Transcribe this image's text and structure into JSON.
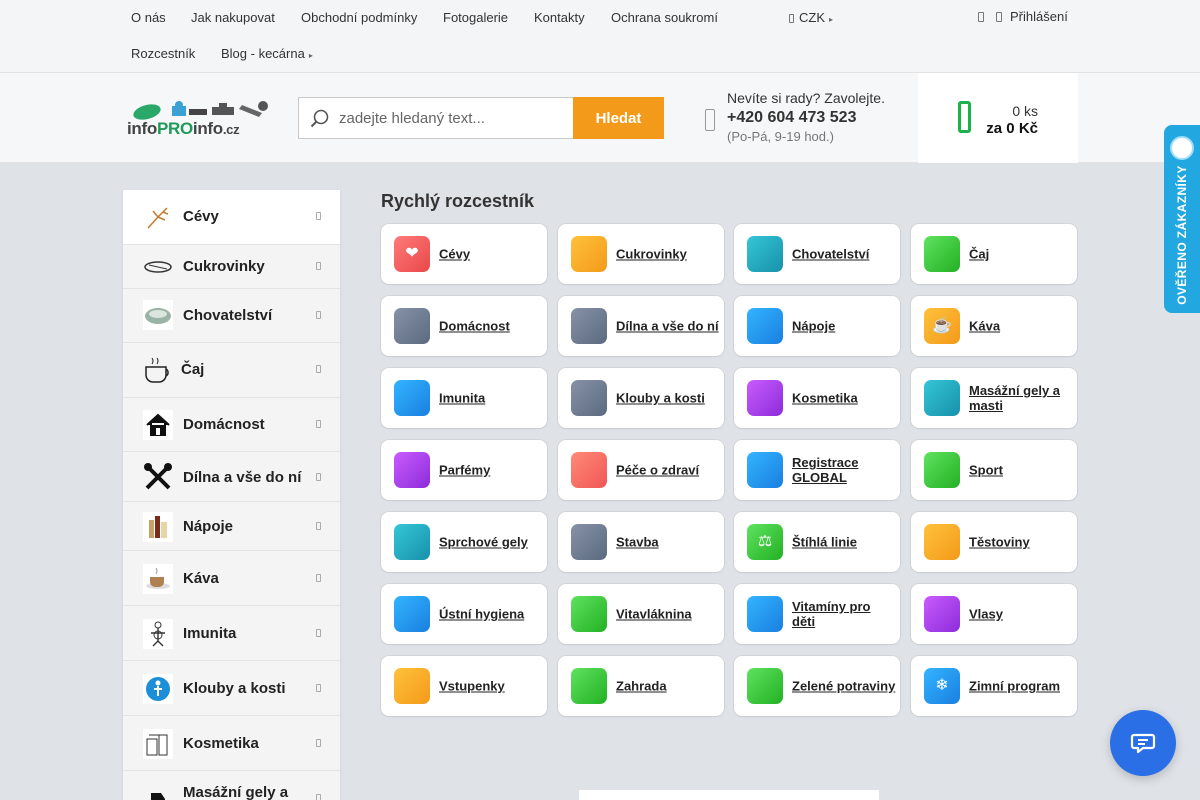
{
  "topnav": {
    "row1": [
      "O nás",
      "Jak nakupovat",
      "Obchodní podmínky",
      "Fotogalerie",
      "Kontakty",
      "Ochrana soukromí"
    ],
    "row2": [
      "Rozcestník",
      "Blog - kecárna"
    ],
    "currency": "CZK",
    "login": "Přihlášení"
  },
  "header": {
    "logo": {
      "part1": "info",
      "part2": "PRO",
      "part3": "info",
      "part4": ".cz"
    },
    "search": {
      "placeholder": "zadejte hledaný text...",
      "button": "Hledat"
    },
    "help": {
      "question": "Nevíte si rady? Zavolejte.",
      "phone": "+420 604 473 523",
      "hours": "(Po-Pá, 9-19 hod.)"
    },
    "cart": {
      "count": "0 ks",
      "total": "za 0 Kč"
    }
  },
  "sidebar": {
    "items": [
      {
        "label": "Cévy",
        "icon": "vein-icon"
      },
      {
        "label": "Cukrovinky",
        "icon": "candy-icon"
      },
      {
        "label": "Chovatelství",
        "icon": "pet-bowl-icon"
      },
      {
        "label": "Čaj",
        "icon": "tea-cup-icon"
      },
      {
        "label": "Domácnost",
        "icon": "house-icon"
      },
      {
        "label": "Dílna a vše do ní",
        "icon": "tools-icon"
      },
      {
        "label": "Nápoje",
        "icon": "drinks-icon"
      },
      {
        "label": "Káva",
        "icon": "coffee-icon"
      },
      {
        "label": "Imunita",
        "icon": "immunity-icon"
      },
      {
        "label": "Klouby a kosti",
        "icon": "joints-icon"
      },
      {
        "label": "Kosmetika",
        "icon": "cosmetics-icon"
      },
      {
        "label": "Masážní gely a",
        "icon": "massage-gel-icon"
      }
    ]
  },
  "main": {
    "title": "Rychlý rozcestník",
    "tiles": [
      {
        "label": "Cévy",
        "icon": "heart-icon",
        "glyph": "❤",
        "color": "red"
      },
      {
        "label": "Cukrovinky",
        "icon": "candy-icon",
        "glyph": "",
        "color": "orange"
      },
      {
        "label": "Chovatelství",
        "icon": "paw-icon",
        "glyph": "",
        "color": "teal"
      },
      {
        "label": "Čaj",
        "icon": "leaf-icon",
        "glyph": "",
        "color": "green"
      },
      {
        "label": "Domácnost",
        "icon": "house-icon",
        "glyph": "",
        "color": "slate"
      },
      {
        "label": "Dílna a vše do ní",
        "icon": "wrench-icon",
        "glyph": "",
        "color": "slate"
      },
      {
        "label": "Nápoje",
        "icon": "bottle-icon",
        "glyph": "",
        "color": "blue"
      },
      {
        "label": "Káva",
        "icon": "coffee-icon",
        "glyph": "☕",
        "color": "orange"
      },
      {
        "label": "Imunita",
        "icon": "shield-icon",
        "glyph": "",
        "color": "blue"
      },
      {
        "label": "Klouby a kosti",
        "icon": "bone-icon",
        "glyph": "",
        "color": "slate"
      },
      {
        "label": "Kosmetika",
        "icon": "lipstick-icon",
        "glyph": "",
        "color": "purple"
      },
      {
        "label": "Masážní gely a masti",
        "icon": "hand-icon",
        "glyph": "",
        "color": "teal"
      },
      {
        "label": "Parfémy",
        "icon": "perfume-icon",
        "glyph": "",
        "color": "purple"
      },
      {
        "label": "Péče o zdraví",
        "icon": "medkit-icon",
        "glyph": "",
        "color": "salmon"
      },
      {
        "label": "Registrace GLOBAL",
        "icon": "globe-icon",
        "glyph": "",
        "color": "blue"
      },
      {
        "label": "Sport",
        "icon": "sport-icon",
        "glyph": "",
        "color": "green"
      },
      {
        "label": "Sprchové gely",
        "icon": "shower-icon",
        "glyph": "",
        "color": "teal"
      },
      {
        "label": "Stavba",
        "icon": "building-icon",
        "glyph": "",
        "color": "slate"
      },
      {
        "label": "Štíhlá linie",
        "icon": "scale-icon",
        "glyph": "⚖",
        "color": "green"
      },
      {
        "label": "Těstoviny",
        "icon": "pasta-icon",
        "glyph": "",
        "color": "orange"
      },
      {
        "label": "Ústní hygiena",
        "icon": "tooth-icon",
        "glyph": "",
        "color": "blue"
      },
      {
        "label": "Vitavláknina",
        "icon": "fiber-icon",
        "glyph": "",
        "color": "green"
      },
      {
        "label": "Vitamíny pro děti",
        "icon": "child-icon",
        "glyph": "",
        "color": "blue"
      },
      {
        "label": "Vlasy",
        "icon": "hair-icon",
        "glyph": "",
        "color": "purple"
      },
      {
        "label": "Vstupenky",
        "icon": "ticket-icon",
        "glyph": "",
        "color": "orange"
      },
      {
        "label": "Zahrada",
        "icon": "garden-icon",
        "glyph": "",
        "color": "green"
      },
      {
        "label": "Zelené potraviny",
        "icon": "vegetable-icon",
        "glyph": "",
        "color": "green"
      },
      {
        "label": "Zimní program",
        "icon": "snowflake-icon",
        "glyph": "❄",
        "color": "blue"
      }
    ]
  },
  "badge": {
    "text": "OVĚŘENO ZÁKAZNÍKY"
  },
  "colors": {
    "accent": "#f39a1a",
    "cart_green": "#1cb24b",
    "badge_blue": "#22a7e1",
    "chat_blue": "#2a6fe6"
  }
}
